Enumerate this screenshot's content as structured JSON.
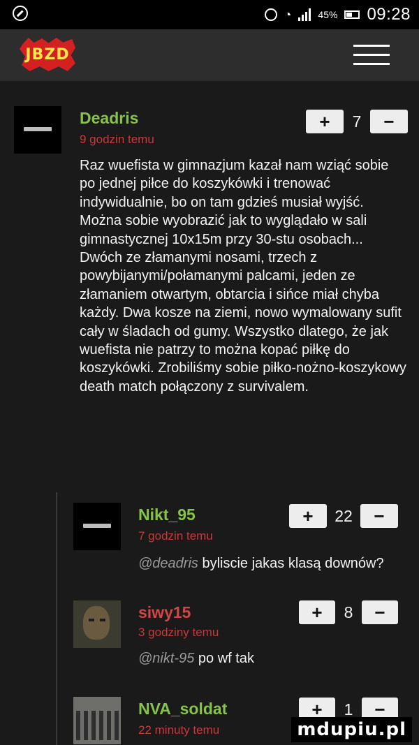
{
  "status_bar": {
    "battery": "45%",
    "time": "09:28",
    "icons": [
      "blocked-icon",
      "alarm-icon",
      "wifi-icon",
      "signal-icon",
      "battery-icon"
    ]
  },
  "header": {
    "logo_text": "JBZD",
    "menu_icon": "hamburger-menu-icon"
  },
  "comments": [
    {
      "username": "Deadris",
      "time": "9 godzin temu",
      "score": "7",
      "text": "Raz wuefista w gimnazjum kazał nam wziąć sobie po jednej piłce do koszykówki i trenować indywidualnie, bo on tam gdzieś musiał wyjść. Można sobie wyobrazić jak to wyglądało w sali gimnastycznej 10x15m przy 30-stu osobach... Dwóch ze złamanymi nosami, trzech z powybijanymi/połamanymi palcami, jeden ze złamaniem otwartym, obtarcia i sińce miał chyba każdy. Dwa kosze na ziemi, nowo wymalowany sufit cały w śladach od gumy. Wszystko dlatego, że jak wuefista nie patrzy to można kopać piłkę do koszykówki. Zrobiliśmy sobie piłko-nożno-koszykowy death match połączony z survivalem."
    },
    {
      "username": "Nikt_95",
      "time": "7 godzin temu",
      "score": "22",
      "mention": "@deadris",
      "text": "byliscie jakas klasą downów?"
    },
    {
      "username": "siwy15",
      "time": "3 godziny temu",
      "score": "8",
      "mention": "@nikt-95",
      "text": "po wf tak"
    },
    {
      "username": "NVA_soldat",
      "time": "22 minuty temu",
      "score": "1"
    }
  ],
  "vote": {
    "plus": "+",
    "minus": "−"
  },
  "watermark": "mdupiu.pl"
}
